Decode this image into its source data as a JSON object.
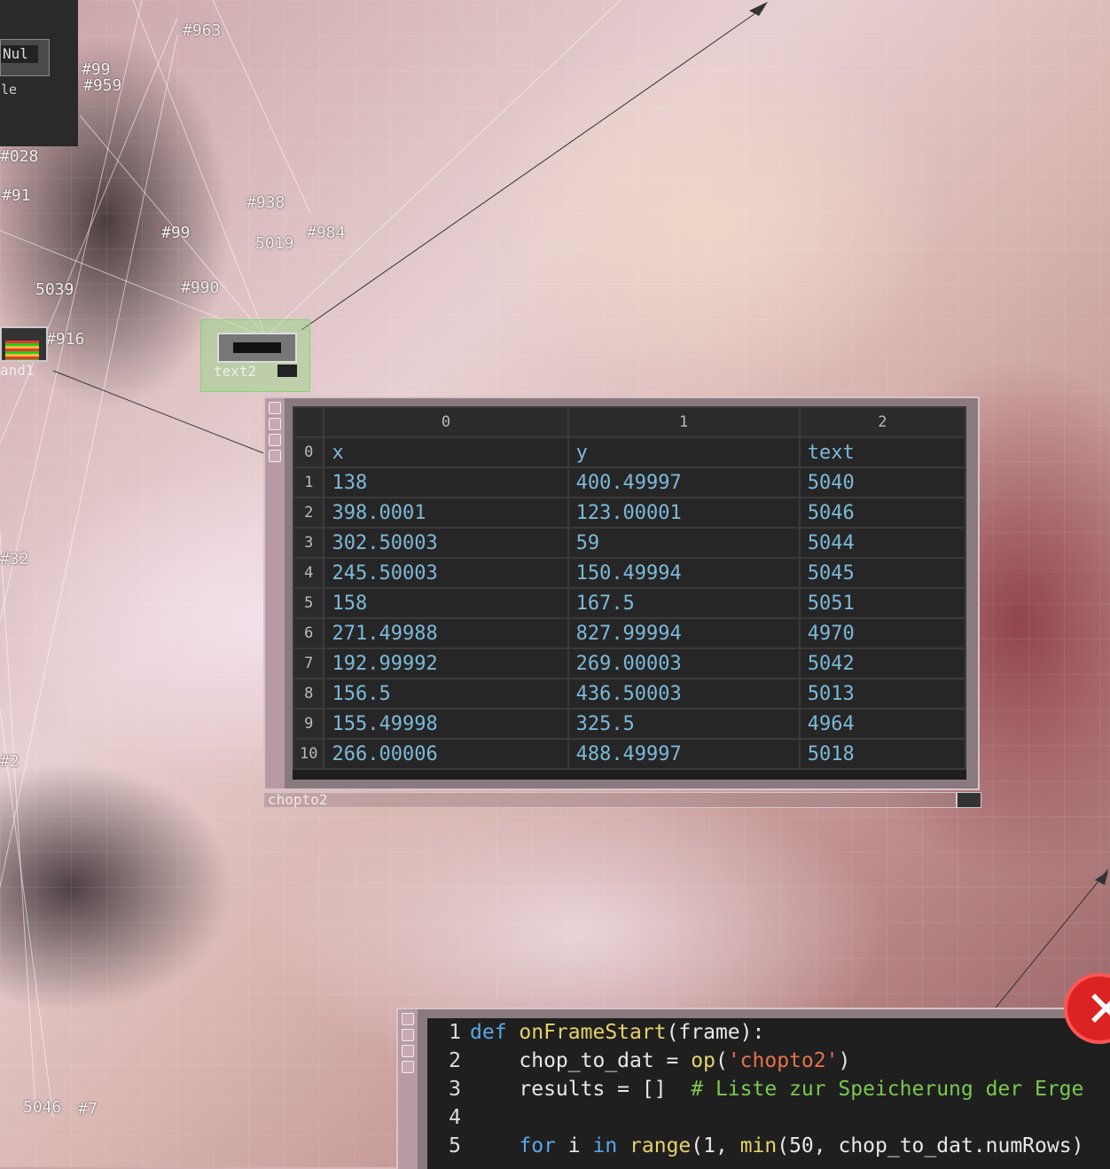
{
  "network": {
    "null_label": "Nul",
    "null_sub": "le",
    "node_ids": [
      "#963",
      "#99",
      "#959",
      "#028",
      "#91",
      "#938",
      "#99",
      "#984",
      "5019",
      "5039",
      "#990",
      "#916",
      "#32",
      "#2",
      "5046",
      "#7"
    ],
    "text2_name": "text2",
    "and_name": "and1"
  },
  "dat": {
    "name": "chopto2",
    "column_headers": [
      "0",
      "1",
      "2"
    ],
    "rows": [
      {
        "idx": "0",
        "c0": "x",
        "c1": "y",
        "c2": "text"
      },
      {
        "idx": "1",
        "c0": "138",
        "c1": "400.49997",
        "c2": "5040"
      },
      {
        "idx": "2",
        "c0": "398.0001",
        "c1": "123.00001",
        "c2": "5046"
      },
      {
        "idx": "3",
        "c0": "302.50003",
        "c1": "59",
        "c2": "5044"
      },
      {
        "idx": "4",
        "c0": "245.50003",
        "c1": "150.49994",
        "c2": "5045"
      },
      {
        "idx": "5",
        "c0": "158",
        "c1": "167.5",
        "c2": "5051"
      },
      {
        "idx": "6",
        "c0": "271.49988",
        "c1": "827.99994",
        "c2": "4970"
      },
      {
        "idx": "7",
        "c0": "192.99992",
        "c1": "269.00003",
        "c2": "5042"
      },
      {
        "idx": "8",
        "c0": "156.5",
        "c1": "436.50003",
        "c2": "5013"
      },
      {
        "idx": "9",
        "c0": "155.49998",
        "c1": "325.5",
        "c2": "4964"
      },
      {
        "idx": "10",
        "c0": "266.00006",
        "c1": "488.49997",
        "c2": "5018"
      }
    ]
  },
  "code": {
    "lines": [
      {
        "n": "1",
        "tokens": [
          [
            "kw",
            "def "
          ],
          [
            "fn",
            "onFrameStart"
          ],
          [
            "code-text",
            "(frame):"
          ]
        ]
      },
      {
        "n": "2",
        "tokens": [
          [
            "code-text",
            "    chop_to_dat = "
          ],
          [
            "fn",
            "op"
          ],
          [
            "code-text",
            "("
          ],
          [
            "str",
            "'chopto2'"
          ],
          [
            "code-text",
            ")"
          ]
        ]
      },
      {
        "n": "3",
        "tokens": [
          [
            "code-text",
            "    results = []  "
          ],
          [
            "cm",
            "# Liste zur Speicherung der Erge"
          ]
        ]
      },
      {
        "n": "4",
        "tokens": [
          [
            "code-text",
            ""
          ]
        ]
      },
      {
        "n": "5",
        "tokens": [
          [
            "code-text",
            "    "
          ],
          [
            "kw",
            "for"
          ],
          [
            "code-text",
            " i "
          ],
          [
            "kw",
            "in"
          ],
          [
            "code-text",
            " "
          ],
          [
            "fn",
            "range"
          ],
          [
            "code-text",
            "(1, "
          ],
          [
            "fn",
            "min"
          ],
          [
            "code-text",
            "(50, chop_to_dat.numRows)"
          ]
        ]
      }
    ]
  },
  "icons": {
    "close": "close-circle-icon"
  },
  "colors": {
    "cell_text": "#7cb9d9",
    "keyword": "#5aa7e6",
    "function": "#e6d36a",
    "string": "#e4724b",
    "comment": "#79c94e",
    "error_badge": "#dd2222"
  }
}
